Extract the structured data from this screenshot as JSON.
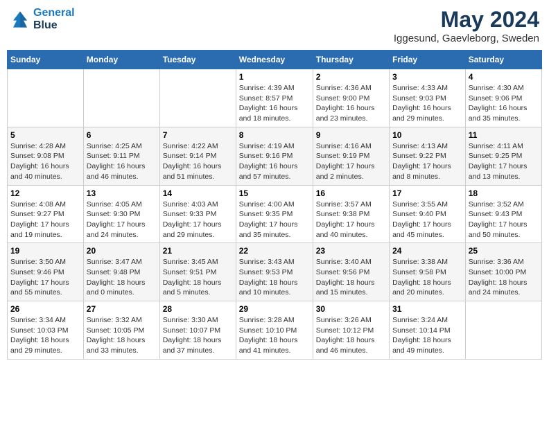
{
  "header": {
    "logo_line1": "General",
    "logo_line2": "Blue",
    "month_title": "May 2024",
    "location": "Iggesund, Gaevleborg, Sweden"
  },
  "days_of_week": [
    "Sunday",
    "Monday",
    "Tuesday",
    "Wednesday",
    "Thursday",
    "Friday",
    "Saturday"
  ],
  "weeks": [
    [
      {
        "day": "",
        "info": ""
      },
      {
        "day": "",
        "info": ""
      },
      {
        "day": "",
        "info": ""
      },
      {
        "day": "1",
        "info": "Sunrise: 4:39 AM\nSunset: 8:57 PM\nDaylight: 16 hours\nand 18 minutes."
      },
      {
        "day": "2",
        "info": "Sunrise: 4:36 AM\nSunset: 9:00 PM\nDaylight: 16 hours\nand 23 minutes."
      },
      {
        "day": "3",
        "info": "Sunrise: 4:33 AM\nSunset: 9:03 PM\nDaylight: 16 hours\nand 29 minutes."
      },
      {
        "day": "4",
        "info": "Sunrise: 4:30 AM\nSunset: 9:06 PM\nDaylight: 16 hours\nand 35 minutes."
      }
    ],
    [
      {
        "day": "5",
        "info": "Sunrise: 4:28 AM\nSunset: 9:08 PM\nDaylight: 16 hours\nand 40 minutes."
      },
      {
        "day": "6",
        "info": "Sunrise: 4:25 AM\nSunset: 9:11 PM\nDaylight: 16 hours\nand 46 minutes."
      },
      {
        "day": "7",
        "info": "Sunrise: 4:22 AM\nSunset: 9:14 PM\nDaylight: 16 hours\nand 51 minutes."
      },
      {
        "day": "8",
        "info": "Sunrise: 4:19 AM\nSunset: 9:16 PM\nDaylight: 16 hours\nand 57 minutes."
      },
      {
        "day": "9",
        "info": "Sunrise: 4:16 AM\nSunset: 9:19 PM\nDaylight: 17 hours\nand 2 minutes."
      },
      {
        "day": "10",
        "info": "Sunrise: 4:13 AM\nSunset: 9:22 PM\nDaylight: 17 hours\nand 8 minutes."
      },
      {
        "day": "11",
        "info": "Sunrise: 4:11 AM\nSunset: 9:25 PM\nDaylight: 17 hours\nand 13 minutes."
      }
    ],
    [
      {
        "day": "12",
        "info": "Sunrise: 4:08 AM\nSunset: 9:27 PM\nDaylight: 17 hours\nand 19 minutes."
      },
      {
        "day": "13",
        "info": "Sunrise: 4:05 AM\nSunset: 9:30 PM\nDaylight: 17 hours\nand 24 minutes."
      },
      {
        "day": "14",
        "info": "Sunrise: 4:03 AM\nSunset: 9:33 PM\nDaylight: 17 hours\nand 29 minutes."
      },
      {
        "day": "15",
        "info": "Sunrise: 4:00 AM\nSunset: 9:35 PM\nDaylight: 17 hours\nand 35 minutes."
      },
      {
        "day": "16",
        "info": "Sunrise: 3:57 AM\nSunset: 9:38 PM\nDaylight: 17 hours\nand 40 minutes."
      },
      {
        "day": "17",
        "info": "Sunrise: 3:55 AM\nSunset: 9:40 PM\nDaylight: 17 hours\nand 45 minutes."
      },
      {
        "day": "18",
        "info": "Sunrise: 3:52 AM\nSunset: 9:43 PM\nDaylight: 17 hours\nand 50 minutes."
      }
    ],
    [
      {
        "day": "19",
        "info": "Sunrise: 3:50 AM\nSunset: 9:46 PM\nDaylight: 17 hours\nand 55 minutes."
      },
      {
        "day": "20",
        "info": "Sunrise: 3:47 AM\nSunset: 9:48 PM\nDaylight: 18 hours\nand 0 minutes."
      },
      {
        "day": "21",
        "info": "Sunrise: 3:45 AM\nSunset: 9:51 PM\nDaylight: 18 hours\nand 5 minutes."
      },
      {
        "day": "22",
        "info": "Sunrise: 3:43 AM\nSunset: 9:53 PM\nDaylight: 18 hours\nand 10 minutes."
      },
      {
        "day": "23",
        "info": "Sunrise: 3:40 AM\nSunset: 9:56 PM\nDaylight: 18 hours\nand 15 minutes."
      },
      {
        "day": "24",
        "info": "Sunrise: 3:38 AM\nSunset: 9:58 PM\nDaylight: 18 hours\nand 20 minutes."
      },
      {
        "day": "25",
        "info": "Sunrise: 3:36 AM\nSunset: 10:00 PM\nDaylight: 18 hours\nand 24 minutes."
      }
    ],
    [
      {
        "day": "26",
        "info": "Sunrise: 3:34 AM\nSunset: 10:03 PM\nDaylight: 18 hours\nand 29 minutes."
      },
      {
        "day": "27",
        "info": "Sunrise: 3:32 AM\nSunset: 10:05 PM\nDaylight: 18 hours\nand 33 minutes."
      },
      {
        "day": "28",
        "info": "Sunrise: 3:30 AM\nSunset: 10:07 PM\nDaylight: 18 hours\nand 37 minutes."
      },
      {
        "day": "29",
        "info": "Sunrise: 3:28 AM\nSunset: 10:10 PM\nDaylight: 18 hours\nand 41 minutes."
      },
      {
        "day": "30",
        "info": "Sunrise: 3:26 AM\nSunset: 10:12 PM\nDaylight: 18 hours\nand 46 minutes."
      },
      {
        "day": "31",
        "info": "Sunrise: 3:24 AM\nSunset: 10:14 PM\nDaylight: 18 hours\nand 49 minutes."
      },
      {
        "day": "",
        "info": ""
      }
    ]
  ]
}
